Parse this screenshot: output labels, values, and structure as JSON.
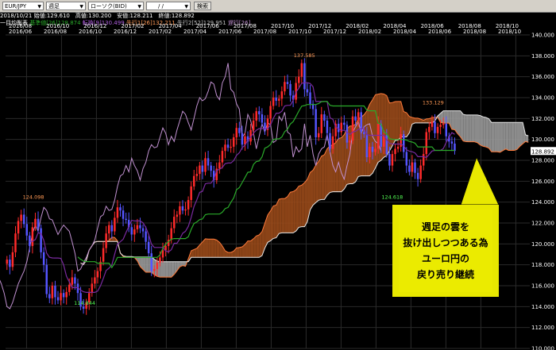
{
  "toolbar": {
    "symbol": "EUR/JPY",
    "timeframe": "週足",
    "chart_kind": "ローソク(BID)",
    "date_input": "/ /",
    "search_label": "検索"
  },
  "ohlc_line": "2018/10/21 始値:129.610　高値:130.200　安値:128.211　終値:128.892",
  "indicator_line": {
    "name": "一目均衡表",
    "kijun": "基準値[26]128.874",
    "tenkan": "転換[9]130.499",
    "senko1": "先行1[26]132.211",
    "senko2": "先行2[52]129.951",
    "chikou": "遅行[26]"
  },
  "colors": {
    "bull": "#ff2a2a",
    "bear": "#5555ff",
    "kumo_bull": "#9a4a1a",
    "kumo_bear": "#9a9a9a",
    "tenkan": "#7a2aa0",
    "kijun": "#2aaa2a",
    "chikou": "#c090d0",
    "callout_bg": "#e8e800"
  },
  "callout": {
    "lines": [
      "週足の雲を",
      "抜け出しつつある為",
      "ユーロ円の",
      "戻り売り継続"
    ]
  },
  "annotations": {
    "high": "137.585",
    "recent_high": "133.129",
    "low": "114.844",
    "mid_low": "124.618",
    "early_high": "124.098"
  },
  "current_price": "128.892",
  "chart_data": {
    "type": "candlestick",
    "title": "",
    "xlabel": "",
    "ylabel": "",
    "ylim": [
      110,
      140
    ],
    "grid": true,
    "y_ticks": [
      "140.000",
      "138.000",
      "136.000",
      "134.000",
      "132.000",
      "130.000",
      "128.000",
      "126.000",
      "124.000",
      "122.000",
      "120.000",
      "118.000",
      "116.000",
      "114.000",
      "112.000",
      "110.000"
    ],
    "x_ticks_top": [
      "2016/06",
      "2016/08",
      "2016/10",
      "2016/12",
      "2017/02",
      "2017/04",
      "2017/06",
      "2017/08",
      "2017/10",
      "2017/12",
      "2018/02",
      "2018/04",
      "2018/06",
      "2018/08",
      "2018/10"
    ],
    "x_ticks_bottom": [
      "2016/08",
      "2016/10",
      "2016/12",
      "2017/02",
      "2017/04",
      "2017/06",
      "2017/08",
      "2017/10",
      "2017/12",
      "2018/02",
      "2018/04",
      "2018/06",
      "2018/08",
      "2018/10"
    ],
    "close": [
      118.5,
      117.8,
      119.2,
      121.0,
      122.2,
      122.8,
      121.9,
      120.8,
      119.8,
      121.6,
      122.4,
      121.5,
      119.2,
      118.0,
      115.2,
      114.8,
      116.0,
      114.9,
      114.6,
      115.3,
      114.9,
      115.4,
      116.1,
      116.8,
      116.2,
      115.3,
      114.0,
      113.8,
      114.4,
      115.3,
      116.2,
      116.8,
      117.4,
      118.3,
      119.6,
      121.0,
      121.8,
      121.2,
      122.5,
      123.5,
      123.2,
      122.4,
      122.3,
      121.6,
      120.9,
      121.4,
      121.8,
      121.5,
      121.2,
      120.2,
      119.1,
      117.4,
      117.6,
      118.2,
      118.7,
      119.4,
      119.8,
      120.4,
      121.5,
      122.6,
      122.8,
      123.6,
      123.2,
      123.3,
      124.2,
      125.5,
      126.5,
      126.7,
      127.5,
      126.9,
      128.2,
      127.5,
      127.0,
      126.1,
      127.2,
      127.8,
      128.9,
      129.5,
      129.2,
      129.3,
      130.2,
      131.1,
      130.6,
      129.5,
      130.3,
      129.8,
      130.9,
      131.8,
      132.7,
      132.4,
      131.6,
      130.9,
      132.0,
      133.2,
      134.0,
      133.7,
      133.9,
      134.6,
      135.5,
      135.3,
      134.2,
      133.8,
      135.4,
      136.0,
      137.3,
      134.8,
      134.5,
      133.4,
      132.9,
      130.2,
      130.6,
      132.4,
      131.8,
      130.6,
      129.1,
      130.3,
      131.5,
      130.7,
      131.6,
      131.4,
      129.7,
      129.9,
      132.2,
      131.8,
      132.6,
      130.7,
      130.5,
      128.3,
      129.3,
      128.8,
      129.1,
      131.5,
      129.3,
      130.4,
      128.6,
      127.5,
      128.6,
      129.1,
      129.3,
      130.5,
      128.8,
      127.5,
      126.9,
      127.8,
      126.8,
      126.2,
      127.5,
      128.6,
      130.7,
      131.2,
      131.7,
      130.6,
      131.2,
      131.4,
      131.5,
      130.3,
      129.8,
      129.6,
      128.9
    ]
  }
}
